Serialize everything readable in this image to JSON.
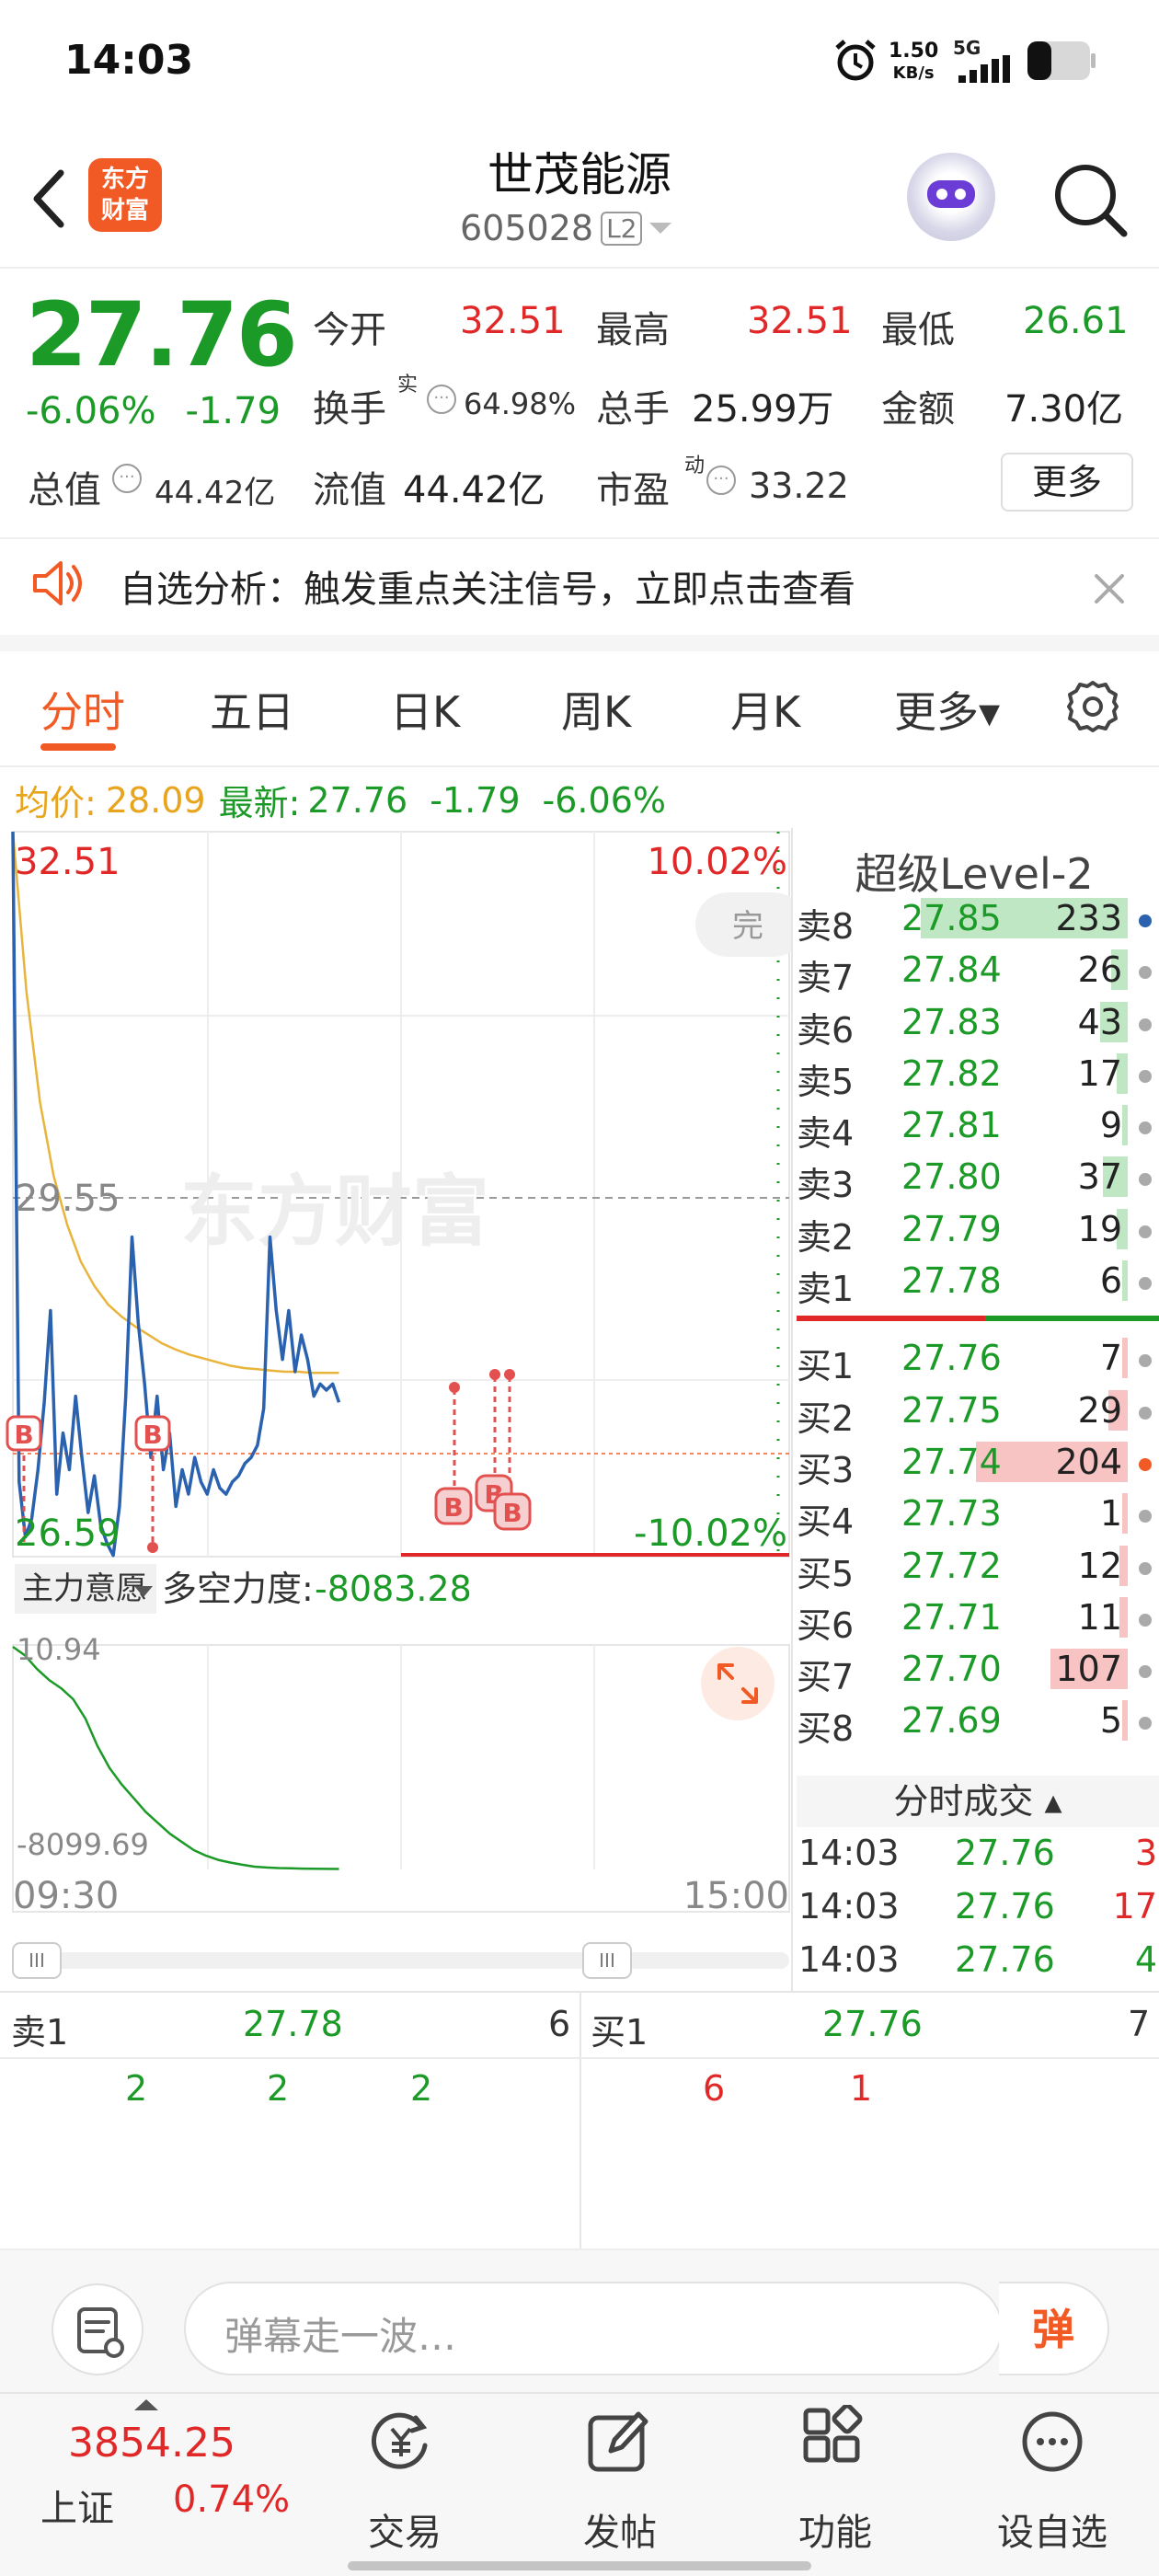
{
  "status_bar": {
    "time": "14:03",
    "net_speed_value": "1.50",
    "net_speed_unit": "KB/s",
    "net_type": "5G"
  },
  "header": {
    "logo_line1": "东方",
    "logo_line2": "财富",
    "stock_name": "世茂能源",
    "stock_code": "605028",
    "level_badge": "L2"
  },
  "quote": {
    "price": "27.76",
    "change_pct": "-6.06%",
    "change": "-1.79",
    "open_label": "今开",
    "open": "32.51",
    "high_label": "最高",
    "high": "32.51",
    "low_label": "最低",
    "low": "26.61",
    "turnover_label": "换手",
    "turnover_sup": "实",
    "turnover": "64.98%",
    "volume_label": "总手",
    "volume": "25.99万",
    "amount_label": "金额",
    "amount": "7.30亿",
    "market_cap_label": "总值",
    "market_cap": "44.42亿",
    "float_cap_label": "流值",
    "float_cap": "44.42亿",
    "pe_label": "市盈",
    "pe_sup": "动",
    "pe": "33.22",
    "more_label": "更多",
    "info_glyph": "···"
  },
  "notice": {
    "text": "自选分析：触发重点关注信号，立即点击查看"
  },
  "tabs": [
    {
      "label": "分时",
      "active": true
    },
    {
      "label": "五日",
      "active": false
    },
    {
      "label": "日K",
      "active": false
    },
    {
      "label": "周K",
      "active": false
    },
    {
      "label": "月K",
      "active": false
    },
    {
      "label": "更多▾",
      "active": false
    }
  ],
  "price_info": {
    "avg_label": "均价:",
    "avg": "28.09",
    "latest_label": "最新:",
    "latest": "27.76",
    "change": "-1.79",
    "change_pct": "-6.06%"
  },
  "chart": {
    "watermark": "东方财富",
    "top_price": "32.51",
    "mid_price": "29.55",
    "bottom_price": "26.59",
    "top_pct": "10.02%",
    "bottom_pct": "-10.02%",
    "complete_label": "完",
    "trade_marker": "B",
    "indicator_label": "主力意愿",
    "indicator_name": "多空力度:",
    "indicator_value": "-8083.28",
    "sub_top": "10.94",
    "sub_bottom": "-8099.69",
    "time_start": "09:30",
    "time_end": "15:00",
    "handle_glyph": "III"
  },
  "chart_data": {
    "type": "line",
    "xlabel": "",
    "ylabel": "",
    "x_range": [
      "09:30",
      "15:00"
    ],
    "ylim": [
      26.59,
      32.51
    ],
    "series": [
      {
        "name": "最新",
        "color": "#2a62b0",
        "values": [
          32.51,
          27.2,
          26.75,
          26.9,
          27.3,
          27.85,
          28.6,
          27.1,
          27.6,
          27.3,
          27.9,
          27.4,
          26.95,
          27.25,
          26.85,
          26.7,
          26.6,
          27.0,
          27.9,
          29.2,
          28.5,
          28.0,
          27.4,
          27.9,
          27.3,
          27.6,
          27.0,
          27.3,
          27.1,
          27.4,
          27.2,
          27.1,
          27.3,
          27.15,
          27.1,
          27.2,
          27.25,
          27.35,
          27.4,
          27.5,
          27.8,
          29.2,
          28.6,
          28.2,
          28.6,
          28.1,
          28.4,
          28.2,
          27.9,
          28.0,
          27.95,
          28.0,
          27.85
        ]
      },
      {
        "name": "均价",
        "color": "#e8b43c",
        "values": [
          32.51,
          31.2,
          30.3,
          29.7,
          29.3,
          29.0,
          28.8,
          28.65,
          28.55,
          28.47,
          28.4,
          28.33,
          28.28,
          28.24,
          28.21,
          28.18,
          28.15,
          28.13,
          28.12,
          28.11,
          28.1,
          28.1,
          28.09,
          28.09,
          28.09
        ]
      }
    ],
    "sub_chart": {
      "name": "多空力度",
      "ylim": [
        -8099.69,
        10.94
      ],
      "values": [
        10.94,
        -300,
        -800,
        -1200,
        -1500,
        -1900,
        -2600,
        -3600,
        -4400,
        -5000,
        -5500,
        -6000,
        -6400,
        -6800,
        -7100,
        -7400,
        -7600,
        -7750,
        -7850,
        -7930,
        -8000,
        -8030,
        -8050,
        -8060,
        -8070,
        -8075,
        -8080,
        -8083.28
      ]
    }
  },
  "level2": {
    "title": "超级Level-2",
    "asks": [
      {
        "label": "卖8",
        "price": "27.85",
        "vol": "233",
        "bar": 0.75,
        "dot": "#2a62b0"
      },
      {
        "label": "卖7",
        "price": "27.84",
        "vol": "26",
        "bar": 0.06,
        "dot": "#aaaaaa"
      },
      {
        "label": "卖6",
        "price": "27.83",
        "vol": "43",
        "bar": 0.1,
        "dot": "#aaaaaa"
      },
      {
        "label": "卖5",
        "price": "27.82",
        "vol": "17",
        "bar": 0.04,
        "dot": "#aaaaaa"
      },
      {
        "label": "卖4",
        "price": "27.81",
        "vol": "9",
        "bar": 0.02,
        "dot": "#aaaaaa"
      },
      {
        "label": "卖3",
        "price": "27.80",
        "vol": "37",
        "bar": 0.09,
        "dot": "#aaaaaa"
      },
      {
        "label": "卖2",
        "price": "27.79",
        "vol": "19",
        "bar": 0.04,
        "dot": "#aaaaaa"
      },
      {
        "label": "卖1",
        "price": "27.78",
        "vol": "6",
        "bar": 0.015,
        "dot": "#aaaaaa"
      }
    ],
    "bids": [
      {
        "label": "买1",
        "price": "27.76",
        "vol": "7",
        "bar": 0.015,
        "dot": "#aaaaaa"
      },
      {
        "label": "买2",
        "price": "27.75",
        "vol": "29",
        "bar": 0.07,
        "dot": "#aaaaaa"
      },
      {
        "label": "买3",
        "price": "27.74",
        "vol": "204",
        "bar": 0.55,
        "dot": "#f15a24"
      },
      {
        "label": "买4",
        "price": "27.73",
        "vol": "1",
        "bar": 0.005,
        "dot": "#aaaaaa"
      },
      {
        "label": "买5",
        "price": "27.72",
        "vol": "12",
        "bar": 0.03,
        "dot": "#aaaaaa"
      },
      {
        "label": "买6",
        "price": "27.71",
        "vol": "11",
        "bar": 0.03,
        "dot": "#aaaaaa"
      },
      {
        "label": "买7",
        "price": "27.70",
        "vol": "107",
        "bar": 0.28,
        "dot": "#aaaaaa"
      },
      {
        "label": "买8",
        "price": "27.69",
        "vol": "5",
        "bar": 0.01,
        "dot": "#aaaaaa"
      }
    ]
  },
  "ticks": {
    "title": "分时成交 ▴",
    "rows": [
      {
        "time": "14:03",
        "price": "27.76",
        "vol": "3",
        "side": "red"
      },
      {
        "time": "14:03",
        "price": "27.76",
        "vol": "17",
        "side": "red"
      },
      {
        "time": "14:03",
        "price": "27.76",
        "vol": "4",
        "side": "green"
      }
    ]
  },
  "order_queue": {
    "ask_label": "卖1",
    "ask_price": "27.78",
    "ask_vol": "6",
    "ask_orders": [
      "2",
      "2",
      "2"
    ],
    "bid_label": "买1",
    "bid_price": "27.76",
    "bid_vol": "7",
    "bid_orders": [
      "6",
      "1"
    ]
  },
  "comment": {
    "placeholder": "弹幕走一波…",
    "danmu_label": "弹"
  },
  "bottom_nav": {
    "index_value": "3854.25",
    "index_name": "上证",
    "index_pct": "0.74%",
    "items": [
      "交易",
      "发帖",
      "功能",
      "设自选"
    ]
  },
  "colors": {
    "brand": "#f15a24",
    "up": "#e02828",
    "down": "#1c9a28",
    "price_line": "#2a62b0",
    "avg_line": "#e8b43c"
  }
}
